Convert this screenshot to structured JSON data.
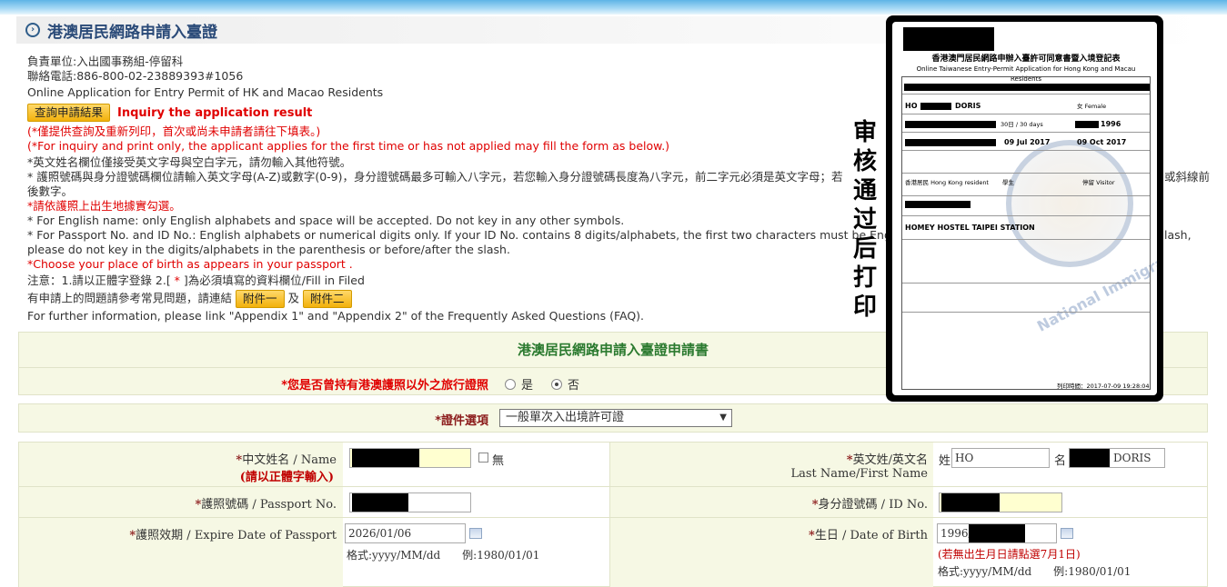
{
  "header": {
    "title": "港澳居民網路申請入臺證"
  },
  "info": {
    "unit": "負責單位:入出國事務組-停留科",
    "phone": "聯絡電話:886-800-02-23889393#1056",
    "english_title": "Online Application for Entry Permit of HK and Macao Residents",
    "inquiry_button": "查詢申請結果",
    "inquiry_link": "Inquiry the application result",
    "note_cn_red": "(*僅提供查詢及重新列印，首次或尚未申請者請往下填表。)",
    "note_en_red": "(*For inquiry and print only, the applicant applies for the first time or has not applied may fill the form as below.)",
    "rule1": "*英文姓名欄位僅接受英文字母與空白字元，請勿輸入其他符號。",
    "rule2a": "* 護照號碼與身分證號碼欄位請輸入英文字母(A-Z)或數字(0-9)，身分證號碼最多可輸入八字元，若您輸入身分證號碼長度為八字元，前二字元必須是英文字母；若",
    "rule2a_end": "或斜線前",
    "rule2b": "後數字。",
    "rule3_red": "*請依護照上出生地據實勾選。",
    "rule4": "* For English name: only English alphabets and space will be  accepted. Do not  key in any other symbols.",
    "rule5a": "* For Passport No. and ID No.: English alphabets or numerical digits only. If your ID No. contains 8 digits/alphabets, the first two characters must be English alphabets.",
    "rule5a_end": "lash,",
    "rule5b": "please do not key in the digits/alphabets in the parenthesis or before/after the slash.",
    "rule6_red": "*Choose your place of birth as appears in your passport .",
    "note_prefix": "注意：1.請以正體字登錄 2.[",
    "note_star": " * ",
    "note_suffix": "]為必須填寫的資料欄位/Fill in Filed",
    "faq_prefix": "有申請上的問題請參考常見問題，請連結",
    "appendix1": "附件一",
    "and": "及",
    "appendix2": "附件二",
    "faq_en": "For further information, please link \"Appendix 1\" and \"Appendix 2\" of the Frequently Asked Questions (FAQ)."
  },
  "form": {
    "title": "港澳居民網路申請入臺證申請書",
    "q_other_passport": "*您是否曾持有港澳護照以外之旅行證照",
    "opt_yes": "是",
    "opt_no": "否",
    "doc_label": "*證件選項",
    "doc_value": "一般單次入出境許可證",
    "cn_name_label": "中文姓名 / Name",
    "cn_name_sub": "(請以正體字輸入)",
    "none_label": "無",
    "en_name_label": "英文姓/英文名",
    "en_name_sub": "Last Name/First Name",
    "surname_label": "姓",
    "surname_value": "HO",
    "given_label": "名",
    "given_value": "DORIS",
    "passport_label": "護照號碼 / Passport No.",
    "id_label": "身分證號碼 / ID No.",
    "expire_label": "護照效期 / Expire Date of Passport",
    "expire_value": "2026/01/06",
    "birth_label": "生日 / Date of Birth",
    "birth_value": "1996/",
    "format_hint": "格式:yyyy/MM/dd　　例:1980/01/01",
    "birth_note": "(若無出生月日請點選7月1日)",
    "star": "*"
  },
  "overlay": {
    "vertical_text": "审核通过后打印",
    "doc_title_cn": "香港澳門居民網路申辦入臺許可同意書暨入境登記表",
    "doc_title_en": "Online Taiwanese Entry-Permit Application for Hong Kong and Macau Residents",
    "name_en": "HO",
    "name_given": "DORIS",
    "sex": "女 Female",
    "duration": "30日 / 30 days",
    "dob_year": "1996",
    "issue_date": "09 Jul 2017",
    "expire_date": "09 Oct 2017",
    "identity": "香港居民 Hong Kong resident",
    "occupation": "學生",
    "visa_type": "停留 Visitor",
    "address": "HOMEY HOSTEL TAIPEI STATION",
    "seal_text": "National Immigration Agency",
    "print_time": "列印時間：2017-07-09 19:28:04"
  }
}
